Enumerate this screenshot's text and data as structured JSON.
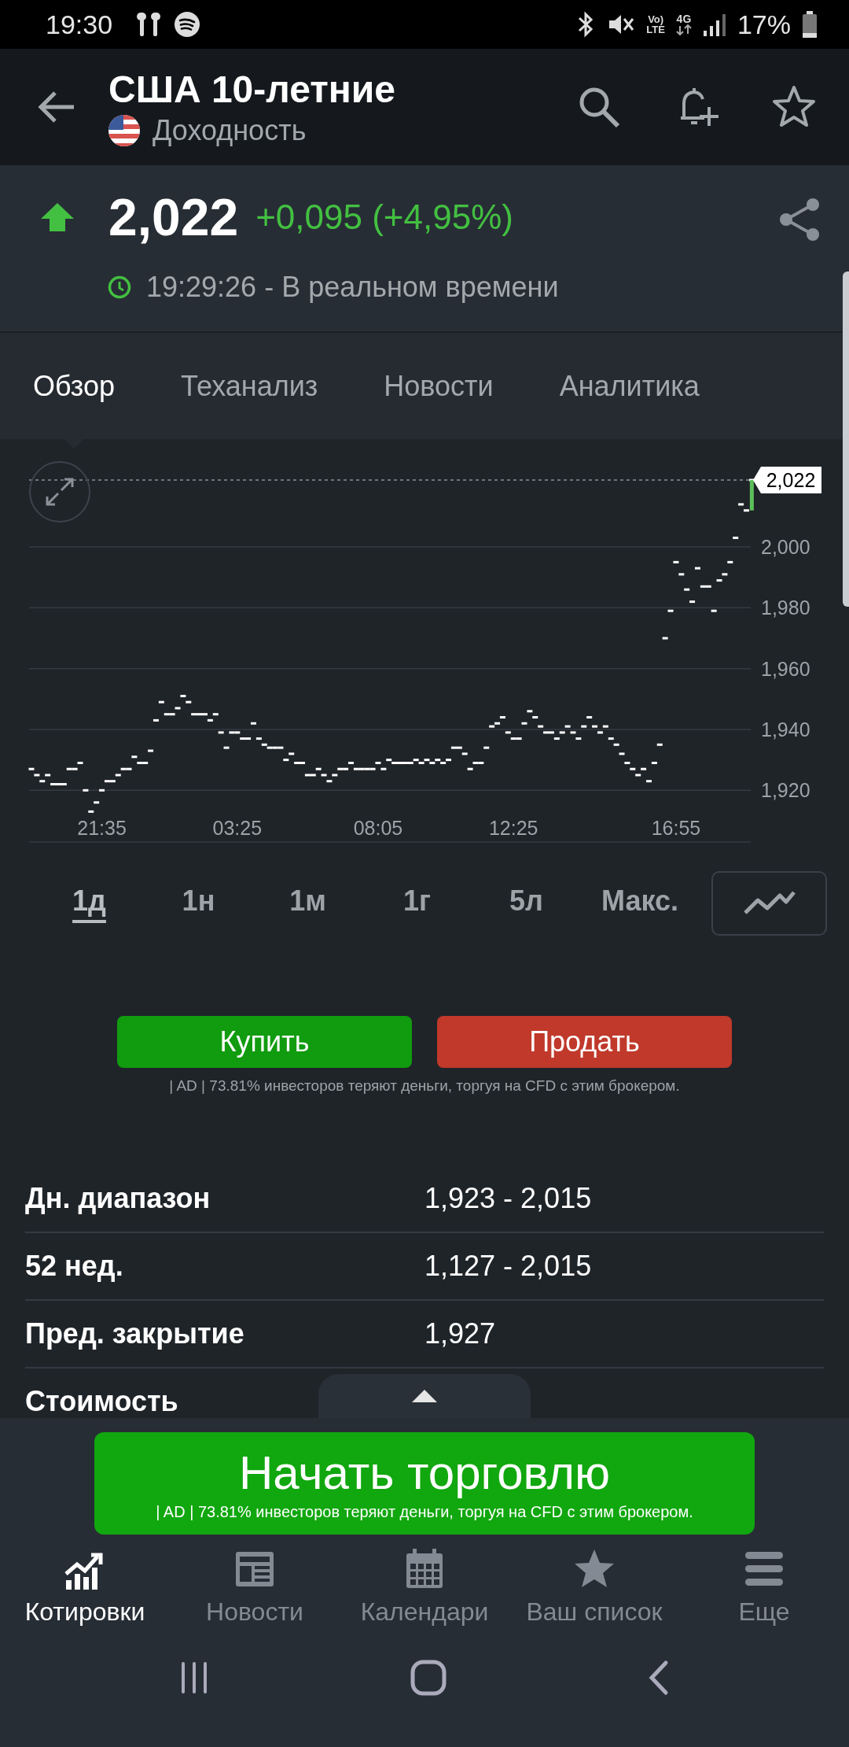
{
  "status_bar": {
    "time": "19:30",
    "volte": {
      "top": "Vo)",
      "bottom": "LTE"
    },
    "network": "4G",
    "battery": "17%"
  },
  "header": {
    "title": "США 10-летние",
    "subtitle": "Доходность"
  },
  "quote": {
    "rising": true,
    "price": "2,022",
    "change": "+0,095 (+4,95%)",
    "time": "19:29:26 - В реальном времени"
  },
  "tabs": [
    {
      "label": "Обзор",
      "selected": true
    },
    {
      "label": "Теханализ",
      "selected": false
    },
    {
      "label": "Новости",
      "selected": false
    },
    {
      "label": "Аналитика",
      "selected": false
    }
  ],
  "chart": {
    "last_price_label": "2,022",
    "chart_data": {
      "type": "scatter",
      "grid": true,
      "ylim": [
        1903,
        2022
      ],
      "yticks": [
        {
          "value": 1920,
          "label": "1,920"
        },
        {
          "value": 1940,
          "label": "1,940"
        },
        {
          "value": 1960,
          "label": "1,960"
        },
        {
          "value": 1980,
          "label": "1,980"
        },
        {
          "value": 2000,
          "label": "2,000"
        }
      ],
      "categories": [
        null,
        null,
        null,
        null,
        null,
        null,
        null,
        null,
        null,
        null,
        null,
        null,
        null,
        "21:35",
        null,
        null,
        null,
        null,
        null,
        null,
        null,
        null,
        null,
        null,
        null,
        null,
        null,
        null,
        null,
        null,
        null,
        null,
        null,
        null,
        null,
        null,
        null,
        null,
        "03:25",
        null,
        null,
        null,
        null,
        null,
        null,
        null,
        null,
        null,
        null,
        null,
        null,
        null,
        null,
        null,
        null,
        null,
        null,
        null,
        null,
        null,
        null,
        null,
        null,
        null,
        "08:05",
        null,
        null,
        null,
        null,
        null,
        null,
        null,
        null,
        null,
        null,
        null,
        null,
        null,
        null,
        null,
        null,
        null,
        null,
        null,
        null,
        null,
        null,
        null,
        null,
        "12:25",
        null,
        null,
        null,
        null,
        null,
        null,
        null,
        null,
        null,
        null,
        null,
        null,
        null,
        null,
        null,
        null,
        null,
        null,
        null,
        null,
        null,
        null,
        null,
        null,
        null,
        null,
        null,
        null,
        null,
        "16:55",
        null,
        null,
        null,
        null,
        null,
        null,
        null,
        null,
        null,
        null,
        null,
        null,
        null,
        null
      ],
      "series": [
        {
          "color": "#ffffff",
          "values": [
            1927,
            1925,
            1923,
            1925,
            1922,
            1922,
            1922,
            1927,
            1927,
            1929,
            1920,
            1913,
            1916,
            1920,
            1923,
            1923,
            1925,
            1927,
            1927,
            1931,
            1929,
            1929,
            1933,
            1943,
            1949,
            1945,
            1945,
            1947,
            1951,
            1949,
            1945,
            1945,
            1945,
            1943,
            1945,
            1939,
            1934,
            1939,
            1939,
            1937,
            1937,
            1942,
            1937,
            1935,
            1934,
            1934,
            1934,
            1930,
            1932,
            1929,
            1929,
            1925,
            1925,
            1927,
            1925,
            1923,
            1925,
            1927,
            1927,
            1929,
            1927,
            1927,
            1927,
            1927,
            1929,
            1927,
            1930,
            1929,
            1929,
            1929,
            1929,
            1930,
            1929,
            1930,
            1929,
            1930,
            1929,
            1930,
            1934,
            1934,
            1932,
            1927,
            1929,
            1929,
            1934,
            1941,
            1942,
            1944,
            1939,
            1937,
            1937,
            1942,
            1946,
            1944,
            1941,
            1939,
            1939,
            1937,
            1939,
            1941,
            1939,
            1937,
            1941,
            1944,
            1941,
            1939,
            1941,
            1937,
            1935,
            1932,
            1929,
            1927,
            1925,
            1927,
            1923,
            1929,
            1935,
            1970,
            1979,
            1995,
            1991,
            1986,
            1982,
            1993,
            1987,
            1987,
            1979,
            1989,
            1991,
            1995,
            2003,
            2014,
            2012,
            2022
          ]
        }
      ]
    }
  },
  "ranges": [
    {
      "label": "1д",
      "selected": true
    },
    {
      "label": "1н",
      "selected": false
    },
    {
      "label": "1м",
      "selected": false
    },
    {
      "label": "1г",
      "selected": false
    },
    {
      "label": "5л",
      "selected": false
    },
    {
      "label": "Макс.",
      "selected": false
    }
  ],
  "trade": {
    "buy": "Купить",
    "sell": "Продать",
    "disclaimer": "| AD | 73.81% инвесторов теряют деньги, торгуя на CFD с этим брокером."
  },
  "stats": [
    {
      "label": "Дн. диапазон",
      "value": "1,923 - 2,015"
    },
    {
      "label": "52 нед.",
      "value": "1,127 - 2,015"
    },
    {
      "label": "Пред. закрытие",
      "value": "1,927"
    },
    {
      "label": "Стоимость"
    }
  ],
  "cta": {
    "label": "Начать торговлю",
    "disclaimer": "| AD | 73.81% инвесторов теряют деньги, торгуя на CFD с этим брокером."
  },
  "nav": [
    {
      "label": "Котировки",
      "kind": "quotes",
      "selected": true
    },
    {
      "label": "Новости",
      "kind": "news",
      "selected": false
    },
    {
      "label": "Календари",
      "kind": "calendar",
      "selected": false
    },
    {
      "label": "Ваш список",
      "kind": "watchlist",
      "selected": false
    },
    {
      "label": "Еще",
      "kind": "more",
      "selected": false
    }
  ]
}
